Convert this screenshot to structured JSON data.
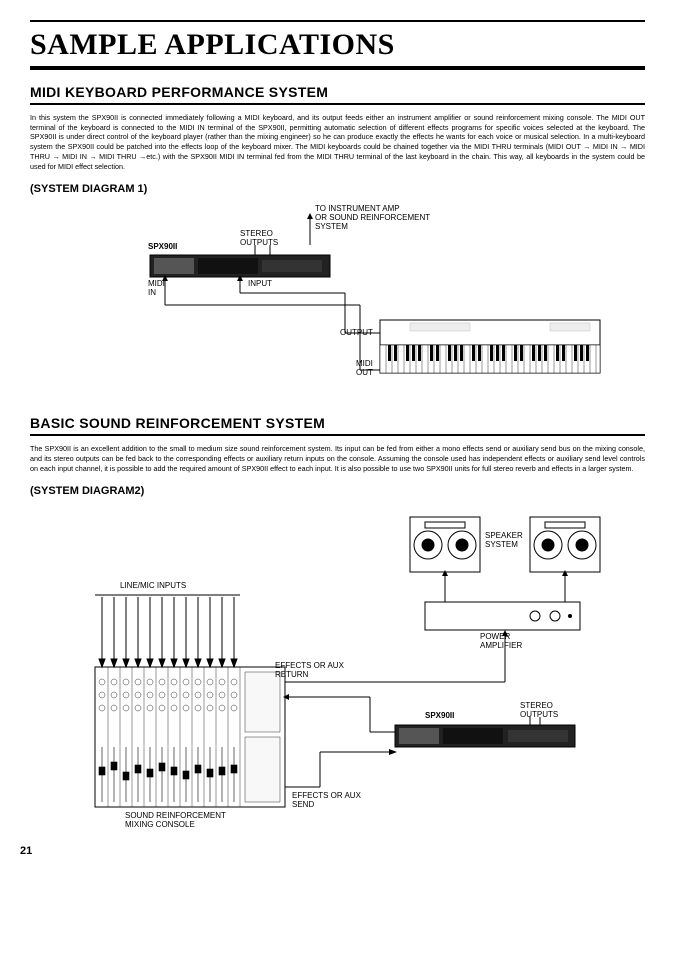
{
  "page": {
    "title": "SAMPLE APPLICATIONS",
    "number": "21"
  },
  "section1": {
    "head": "MIDI KEYBOARD PERFORMANCE SYSTEM",
    "body": "In this system the SPX90II is connected immediately following a MIDI keyboard, and its output feeds either an instrument amplifier or sound reinforcement mixing console. The MIDI OUT terminal of the keyboard is connected to the MIDI IN terminal of the SPX90II, permitting automatic selection of different effects programs for specific voices selected at the keyboard. The SPX90II is under direct control of the keyboard player (rather than the mixing engineer) so he can produce exactly the effects he wants for each voice or musical selection. In a multi-keyboard system the SPX90II could be patched into the effects loop of the keyboard mixer. The MIDI keyboards could be chained together via the MIDI THRU terminals (MIDI OUT → MIDI IN → MIDI THRU → MIDI IN → MIDI THRU →etc.) with the SPX90II MIDI IN terminal fed from the MIDI THRU terminal of the last keyboard in the chain. This way, all keyboards in the system could be used for MIDI effect selection.",
    "subhead": "(SYSTEM DIAGRAM 1)",
    "labels": {
      "toamp": "TO INSTRUMENT AMP\nOR SOUND REINFORCEMENT\nSYSTEM",
      "spx": "SPX90II",
      "stereo": "STEREO\nOUTPUTS",
      "midiin": "MIDI\nIN",
      "input": "INPUT",
      "output": "OUTPUT",
      "midiout": "MIDI\nOUT"
    }
  },
  "section2": {
    "head": "BASIC SOUND REINFORCEMENT SYSTEM",
    "body": "The SPX90II is an excellent addition to the small to medium size sound reinforcement system. Its input can be fed from either a mono effects send or auxiliary send bus on the mixing console, and its stereo outputs can be fed back to the corresponding effects or auxiliary return inputs on the console. Assuming the console used has independent effects or auxiliary send level controls on each input channel, it is possible to add the required amount of SPX90II effect to each input. It is also possible to use two SPX90II units for full stereo reverb and effects in a larger system.",
    "subhead": "(SYSTEM DIAGRAM2)",
    "labels": {
      "linemic": "LINE/MIC INPUTS",
      "speaker": "SPEAKER\nSYSTEM",
      "poweramp": "POWER\nAMPLIFIER",
      "fxreturn": "EFFECTS OR AUX\nRETURN",
      "spx": "SPX90II",
      "stereo": "STEREO\nOUTPUTS",
      "fxsend": "EFFECTS OR AUX\nSEND",
      "console": "SOUND REINFORCEMENT\nMIXING CONSOLE"
    }
  }
}
